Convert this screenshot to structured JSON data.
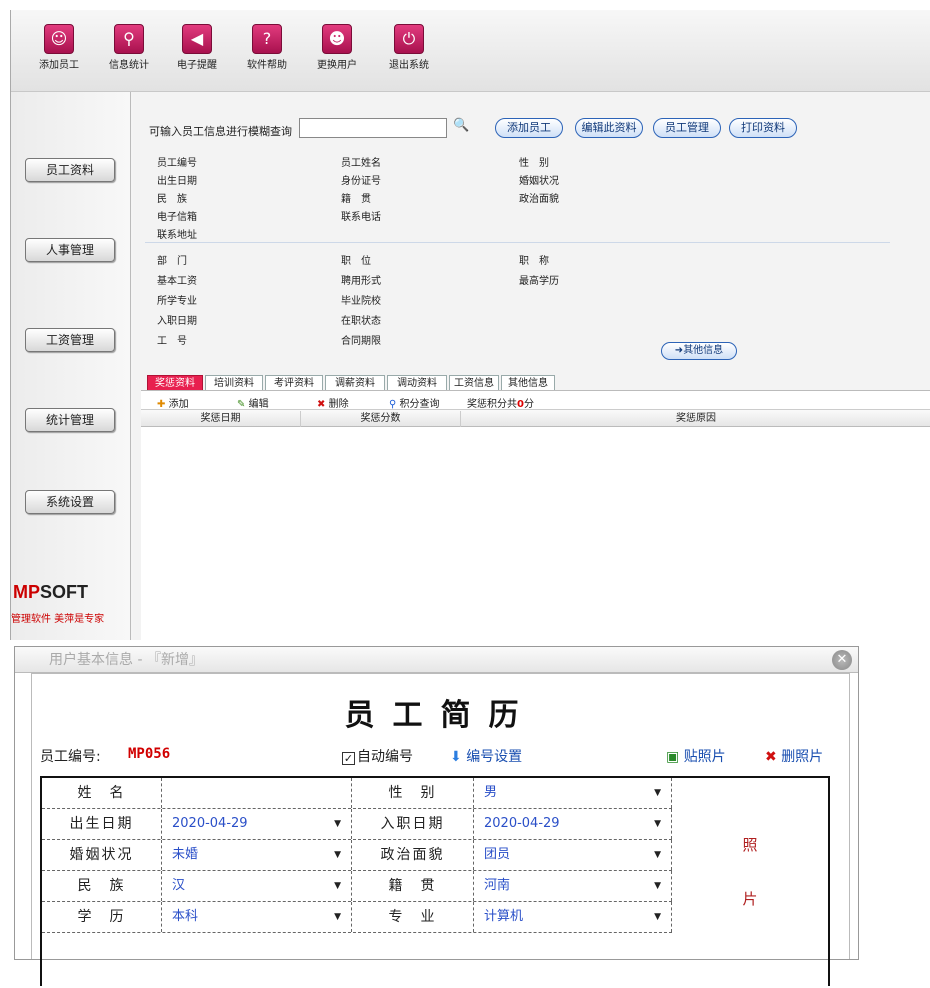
{
  "toolbar": {
    "items": [
      {
        "label": "添加员工",
        "icon": "user-add-icon"
      },
      {
        "label": "信息统计",
        "icon": "search-icon"
      },
      {
        "label": "电子提醒",
        "icon": "speaker-icon"
      },
      {
        "label": "软件帮助",
        "icon": "help-icon"
      },
      {
        "label": "更换用户",
        "icon": "users-icon"
      },
      {
        "label": "退出系统",
        "icon": "power-icon"
      }
    ]
  },
  "sidebar": {
    "items": [
      "员工资料",
      "人事管理",
      "工资管理",
      "统计管理",
      "系统设置"
    ],
    "logo_a": "MP",
    "logo_b": "SOFT",
    "slogan": "管理软件 美萍是专家"
  },
  "search": {
    "label": "可输入员工信息进行模糊查询",
    "value": "",
    "buttons": [
      "添加员工",
      "编辑此资料",
      "员工管理",
      "打印资料"
    ]
  },
  "fields": {
    "col1": [
      "员工编号",
      "出生日期",
      "民　族",
      "电子信箱",
      "联系地址",
      "部　门",
      "基本工资",
      "所学专业",
      "入职日期",
      "工　号"
    ],
    "col2": [
      "员工姓名",
      "身份证号",
      "籍　贯",
      "联系电话",
      "职　位",
      "聘用形式",
      "毕业院校",
      "在职状态",
      "合同期限"
    ],
    "col3": [
      "性　别",
      "婚姻状况",
      "政治面貌",
      "职　称",
      "最高学历"
    ],
    "other_info": "其他信息"
  },
  "tabs": [
    "奖惩资料",
    "培训资料",
    "考评资料",
    "调薪资料",
    "调动资料",
    "工资信息",
    "其他信息"
  ],
  "grid": {
    "add": "添加",
    "edit": "编辑",
    "delete": "删除",
    "points_query": "积分查询",
    "points_total_prefix": "奖惩积分共",
    "points_total_value": "0",
    "points_total_suffix": "分",
    "columns": [
      "奖惩日期",
      "奖惩分数",
      "奖惩原因"
    ]
  },
  "dialog": {
    "title": "用户基本信息 - 『新增』",
    "heading": "员工简历",
    "emp_no_label": "员工编号:",
    "emp_no_value": "MP056",
    "auto_number": "自动编号",
    "auto_checked": "✓",
    "number_setting": "编号设置",
    "paste_photo": "贴照片",
    "delete_photo": "删照片",
    "photo_1": "照",
    "photo_2": "片",
    "rows": [
      {
        "l1": "姓　名",
        "v1": "",
        "l2": "性　别",
        "v2": "男"
      },
      {
        "l1": "出生日期",
        "v1": "2020-04-29",
        "l2": "入职日期",
        "v2": "2020-04-29"
      },
      {
        "l1": "婚姻状况",
        "v1": "未婚",
        "l2": "政治面貌",
        "v2": "团员"
      },
      {
        "l1": "民　族",
        "v1": "汉",
        "l2": "籍　贯",
        "v2": "河南"
      },
      {
        "l1": "学　历",
        "v1": "本科",
        "l2": "专　业",
        "v2": "计算机"
      }
    ]
  }
}
